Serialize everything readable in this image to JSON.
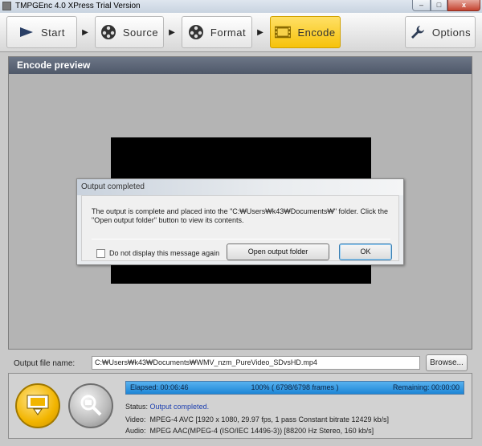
{
  "window": {
    "title": "TMPGEnc 4.0 XPress Trial Version",
    "minimize_glyph": "–",
    "maximize_glyph": "□",
    "close_glyph": "x"
  },
  "toolbar": {
    "start": "Start",
    "source": "Source",
    "format": "Format",
    "encode": "Encode",
    "options": "Options",
    "arrow_glyph": "▶"
  },
  "preview": {
    "header": "Encode preview"
  },
  "dialog": {
    "title": "Output completed",
    "message": "The output is complete and placed into the \"C:₩Users₩k43₩Documents₩\" folder. Click the \"Open output folder\" button to view its contents.",
    "checkbox_label": "Do not display this message again",
    "open_button": "Open output folder",
    "ok_button": "OK"
  },
  "output": {
    "label": "Output file name:",
    "value": "C:₩Users₩k43₩Documents₩WMV_nzm_PureVideo_SDvsHD.mp4",
    "browse": "Browse..."
  },
  "status": {
    "elapsed": "Elapsed: 00:06:46",
    "progress_text": "100% ( 6798/6798  frames )",
    "progress_percent": 100,
    "remaining": "Remaining: 00:00:00",
    "status_label": "Status:",
    "status_value": "Output completed.",
    "video_label": "Video:",
    "video_value": "MPEG-4 AVC [1920 x 1080, 29.97 fps, 1 pass Constant bitrate 12429 kb/s]",
    "audio_label": "Audio:",
    "audio_value": "MPEG AAC(MPEG-4 (ISO/IEC 14496-3)) [88200 Hz Stereo, 160 kb/s]"
  },
  "colors": {
    "accent": "#f6c20a",
    "progress": "#1d86d6",
    "status_text": "#1c3fb0"
  }
}
